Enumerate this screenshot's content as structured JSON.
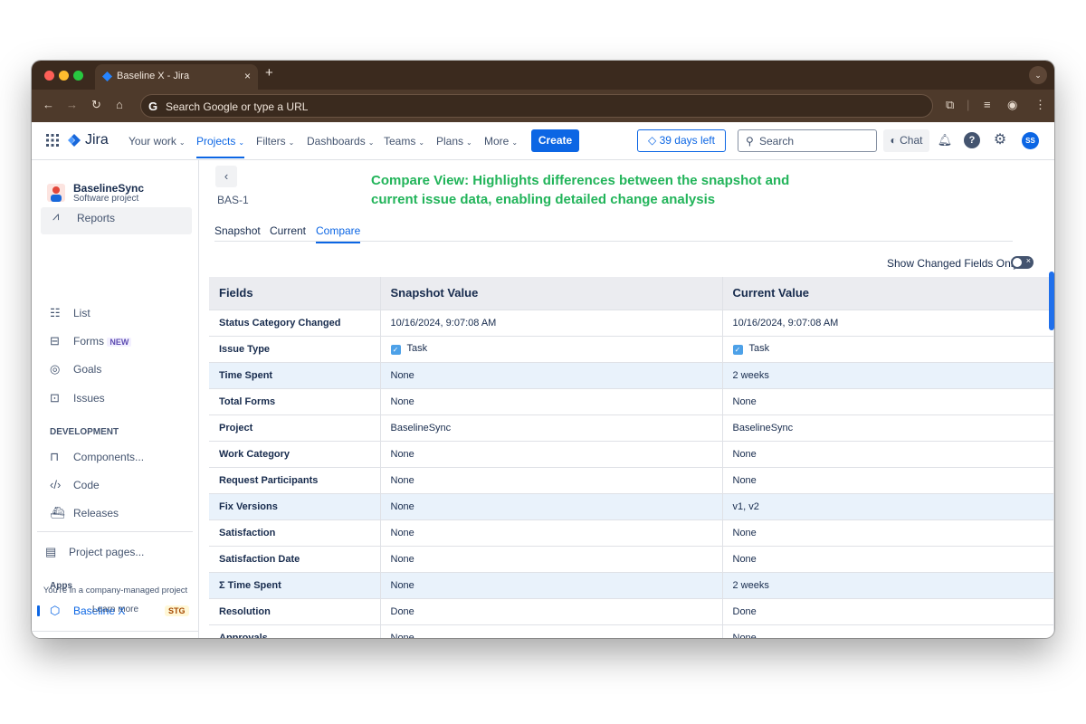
{
  "browser": {
    "tab_title": "Baseline X - Jira",
    "tab_close": "×",
    "new_tab": "+",
    "tab_menu": "⌄",
    "omnibox_placeholder": "Search Google or type a URL",
    "omnibox_icon": "G"
  },
  "jira_header": {
    "logo": "Jira",
    "nav": [
      {
        "label": "Your work"
      },
      {
        "label": "Projects"
      },
      {
        "label": "Filters"
      },
      {
        "label": "Dashboards"
      },
      {
        "label": "Teams"
      },
      {
        "label": "Plans"
      },
      {
        "label": "More"
      }
    ],
    "create": "Create",
    "trial": "39 days left",
    "search_placeholder": "Search",
    "chat": "Chat",
    "avatar_initials": "SS"
  },
  "sidebar": {
    "project_name": "BaselineSync",
    "project_type": "Software project",
    "reports": "Reports",
    "items": [
      {
        "label": "List",
        "icon": "list-icon"
      },
      {
        "label": "Forms",
        "badge": "NEW",
        "icon": "forms-icon"
      },
      {
        "label": "Goals",
        "icon": "goals-icon"
      },
      {
        "label": "Issues",
        "icon": "issues-icon"
      }
    ],
    "dev_section": "DEVELOPMENT",
    "dev_items": [
      {
        "label": "Components..."
      },
      {
        "label": "Code"
      },
      {
        "label": "Releases"
      }
    ],
    "project_pages": "Project pages...",
    "apps_section": "Apps",
    "app": {
      "label": "Baseline X",
      "badge": "STG"
    },
    "footer_text": "You're in a company-managed project",
    "learn_more": "Learn more"
  },
  "main": {
    "issue_key": "BAS-1",
    "annotation": "Compare View: Highlights differences between the snapshot and current issue data, enabling detailed change analysis",
    "tabs": [
      "Snapshot",
      "Current",
      "Compare"
    ],
    "active_tab": "Compare",
    "toggle_label": "Show Changed Fields Only",
    "table": {
      "headers": [
        "Fields",
        "Snapshot Value",
        "Current Value"
      ],
      "rows": [
        {
          "field": "Status Category Changed",
          "snapshot": "10/16/2024, 9:07:08 AM",
          "current": "10/16/2024, 9:07:08 AM",
          "changed": false
        },
        {
          "field": "Issue Type",
          "snapshot": "Task",
          "current": "Task",
          "changed": false,
          "checkbox": true
        },
        {
          "field": "Time Spent",
          "snapshot": "None",
          "current": "2 weeks",
          "changed": true
        },
        {
          "field": "Total Forms",
          "snapshot": "None",
          "current": "None",
          "changed": false
        },
        {
          "field": "Project",
          "snapshot": "BaselineSync",
          "current": "BaselineSync",
          "changed": false
        },
        {
          "field": "Work Category",
          "snapshot": "None",
          "current": "None",
          "changed": false
        },
        {
          "field": "Request Participants",
          "snapshot": "None",
          "current": "None",
          "changed": false
        },
        {
          "field": "Fix Versions",
          "snapshot": "None",
          "current": "v1, v2",
          "changed": true
        },
        {
          "field": "Satisfaction",
          "snapshot": "None",
          "current": "None",
          "changed": false
        },
        {
          "field": "Satisfaction Date",
          "snapshot": "None",
          "current": "None",
          "changed": false
        },
        {
          "field": "Σ Time Spent",
          "snapshot": "None",
          "current": "2 weeks",
          "changed": true
        },
        {
          "field": "Resolution",
          "snapshot": "Done",
          "current": "Done",
          "changed": false
        },
        {
          "field": "Approvals",
          "snapshot": "None",
          "current": "None",
          "changed": false
        }
      ]
    }
  }
}
